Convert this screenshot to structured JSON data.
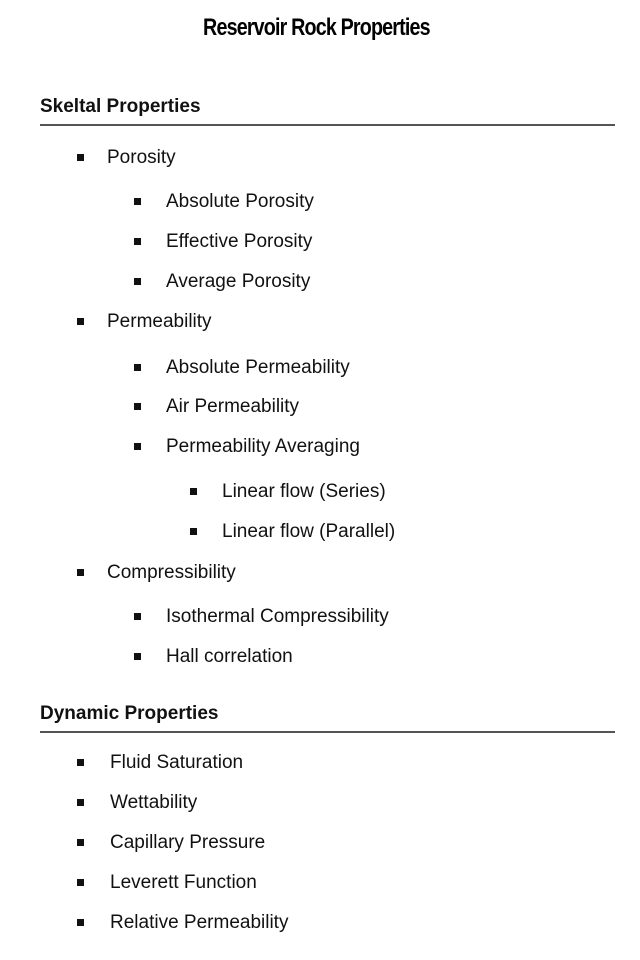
{
  "title": "Reservoir Rock Properties",
  "sections": [
    {
      "heading": "Skeltal Properties",
      "items": [
        {
          "label": "Porosity",
          "level": 1
        },
        {
          "label": "Absolute Porosity",
          "level": 2
        },
        {
          "label": "Effective Porosity",
          "level": 2
        },
        {
          "label": "Average Porosity",
          "level": 2
        },
        {
          "label": "Permeability",
          "level": 1
        },
        {
          "label": "Absolute Permeability",
          "level": 2
        },
        {
          "label": "Air Permeability",
          "level": 2
        },
        {
          "label": "Permeability Averaging",
          "level": 2
        },
        {
          "label": "Linear flow (Series)",
          "level": 3
        },
        {
          "label": "Linear flow (Parallel)",
          "level": 3
        },
        {
          "label": "Compressibility",
          "level": 1
        },
        {
          "label": "Isothermal Compressibility",
          "level": 2
        },
        {
          "label": "Hall correlation",
          "level": 2
        }
      ]
    },
    {
      "heading": "Dynamic Properties",
      "items": [
        {
          "label": "Fluid Saturation",
          "level": 1
        },
        {
          "label": "Wettability",
          "level": 1
        },
        {
          "label": "Capillary Pressure",
          "level": 1
        },
        {
          "label": "Leverett Function",
          "level": 1
        },
        {
          "label": "Relative Permeability",
          "level": 1
        }
      ]
    }
  ]
}
